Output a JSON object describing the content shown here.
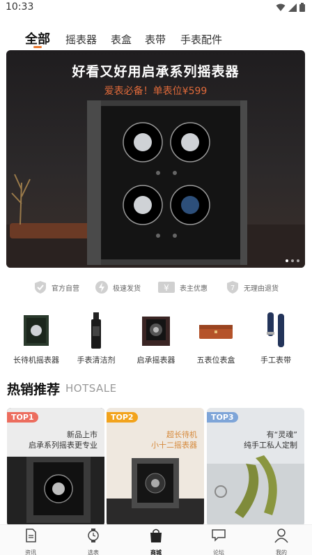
{
  "status": {
    "time": "10:33"
  },
  "tabs": [
    {
      "label": "全部",
      "active": true
    },
    {
      "label": "摇表器"
    },
    {
      "label": "表盒"
    },
    {
      "label": "表带"
    },
    {
      "label": "手表配件"
    }
  ],
  "banner": {
    "title": "好看又好用启承系列摇表器",
    "subtitle": "爱表必备！单表位¥599",
    "slide_count": 3,
    "active_slide": 0
  },
  "features": [
    {
      "icon": "check-shield-icon",
      "label": "官方自营"
    },
    {
      "icon": "lightning-icon",
      "label": "极速发货"
    },
    {
      "icon": "yen-icon",
      "label": "表主优惠"
    },
    {
      "icon": "return-7-icon",
      "label": "无理由退货"
    }
  ],
  "categories": [
    {
      "icon": "long-standby-winder-icon",
      "label": "长待机摇表器"
    },
    {
      "icon": "cleaner-bottle-icon",
      "label": "手表清洁剂"
    },
    {
      "icon": "qicheng-winder-icon",
      "label": "启承摇表器"
    },
    {
      "icon": "five-slot-box-icon",
      "label": "五表位表盒"
    },
    {
      "icon": "watch-strap-icon",
      "label": "手工表带"
    }
  ],
  "hot_sale": {
    "title": "热销推荐",
    "title_en": "HOTSALE",
    "products": [
      {
        "badge": "TOP1",
        "badge_color": "#ec6d5e",
        "caption_line1": "新品上市",
        "caption_line2": "启承系列摇表更专业"
      },
      {
        "badge": "TOP2",
        "badge_color": "#f2a31c",
        "caption_line1": "超长待机",
        "caption_line2": "小十二摇表器"
      },
      {
        "badge": "TOP3",
        "badge_color": "#7ea5d8",
        "caption_line1": "有“灵魂”",
        "caption_line2": "纯手工私人定制"
      }
    ]
  },
  "bottom_nav": [
    {
      "icon": "news-doc-icon",
      "label": "资讯"
    },
    {
      "icon": "watch-select-icon",
      "label": "选表"
    },
    {
      "icon": "shop-bag-icon",
      "label": "商城",
      "active": true
    },
    {
      "icon": "forum-chat-icon",
      "label": "论坛"
    },
    {
      "icon": "profile-icon",
      "label": "我的"
    }
  ],
  "colors": {
    "accent": "#e8762c",
    "banner_sub": "#e06a3a"
  }
}
